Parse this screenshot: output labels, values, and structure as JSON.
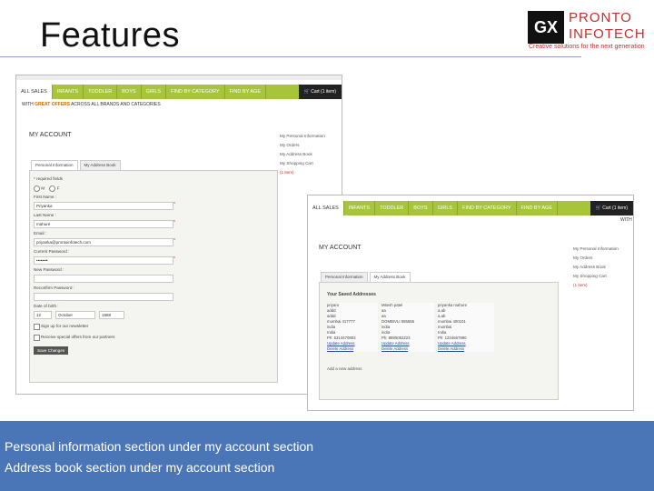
{
  "slide": {
    "title": "Features",
    "caption": {
      "line1": "Personal information section under my account section",
      "line2": "Address book section under my account section"
    }
  },
  "logo": {
    "mark": "GX",
    "name_line1": "PRONTO",
    "name_line2": "INFOTECH",
    "tagline": "Creative solutions for the next generation"
  },
  "colors": {
    "nav_green": "#a8c43a",
    "caption_blue": "#4a76b8",
    "logo_red": "#c0322e"
  },
  "shot1": {
    "nav": [
      "ALL SALES",
      "INFANTS",
      "TODDLER",
      "BOYS",
      "GIRLS",
      "FIND BY CATEGORY",
      "FIND BY AGE"
    ],
    "cart": "Cart (1 item)",
    "offers_prefix": "WITH",
    "offers_highlight": "GREAT OFFERS",
    "offers_suffix": "ACROSS ALL BRANDS AND CATEGORIES",
    "account_title": "MY ACCOUNT",
    "side_links": [
      "My Personal Information",
      "My Orders",
      "My Address Book"
    ],
    "side_cart_text": "My Shopping Cart",
    "side_cart_count": "(1 item)",
    "tabs": [
      "Personal Information",
      "My Address Book"
    ],
    "form": {
      "required_note": "* required fields",
      "gender_label": "M",
      "gender_opt": "F",
      "first_name_label": "First Name :",
      "first_name_value": "Priyanka",
      "last_name_label": "Last Name :",
      "last_name_value": "mahure",
      "email_label": "Email :",
      "email_value": "priyanka@prontoinfotech.com",
      "current_password_label": "Current Password :",
      "current_password_value": "••••••••",
      "new_password_label": "New Password :",
      "reconfirm_label": "Reconfirm Password :",
      "dob_label": "Date of birth :",
      "dob_day": "12",
      "dob_month": "October",
      "dob_year": "1988",
      "newsletter_label": "Sign up for our newsletter",
      "partners_label": "Receive special offers from our partners",
      "save_button": "Save Changes"
    }
  },
  "shot2": {
    "nav": [
      "ALL SALES",
      "INFANTS",
      "TODDLER",
      "BOYS",
      "GIRLS",
      "FIND BY CATEGORY",
      "FIND BY AGE"
    ],
    "cart": "Cart (1 item)",
    "with_text": "WITH",
    "account_title": "MY ACCOUNT",
    "side_links": [
      "My Personal Information",
      "My Orders",
      "My Address Book"
    ],
    "side_cart_text": "My Shopping Cart",
    "side_cart_count": "(1 item)",
    "tabs": [
      "Personal Information",
      "My Address Book"
    ],
    "saved_heading": "Your Saved Addresses",
    "addresses": [
      {
        "lines": [
          "priyaro",
          "addd",
          "addd",
          "mumbai 417777",
          "india",
          "India",
          "Ph: 5314470803"
        ],
        "update": "Update Address",
        "delete": "Delete Address"
      },
      {
        "lines": [
          "Mitesh patel",
          "aa",
          "aa",
          "DOMBIVLI 555555",
          "india",
          "india",
          "Ph: 8595052223"
        ],
        "update": "Update Address",
        "delete": "Delete Address"
      },
      {
        "lines": [
          "priyanka mahure",
          "a,ab",
          "a,ab",
          "mumbai 400101",
          "mumbai",
          "India",
          "Ph: 1234567890"
        ],
        "update": "Update Address",
        "delete": "Delete Address"
      }
    ],
    "add_new": "Add a new address"
  }
}
